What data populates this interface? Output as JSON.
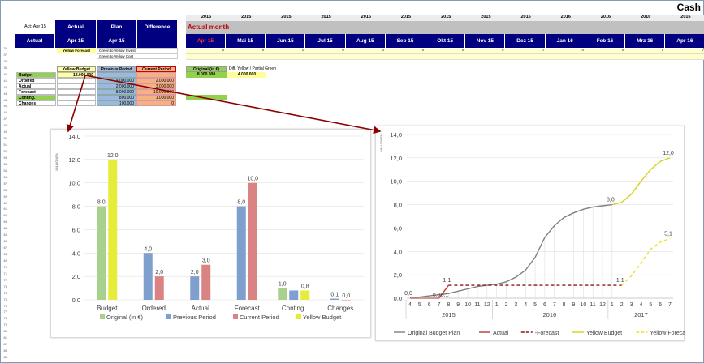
{
  "sheet": {
    "title": "Cash",
    "act_label": "Act: Apr 15",
    "headers": {
      "actual": "Actual",
      "plan": "Plan",
      "difference": "Difference",
      "actual_month": "Actual month"
    },
    "row2": {
      "actual": "Actual",
      "apr": "Apr 15",
      "plan_apr": "Apr 15"
    },
    "years": [
      "2015",
      "2015",
      "2015",
      "2015",
      "2015",
      "2015",
      "2015",
      "2015",
      "2015",
      "2016",
      "2016",
      "2016",
      "2016"
    ],
    "months": [
      "Apr 15",
      "Mai 15",
      "Jun 15",
      "Jul 15",
      "Aug 15",
      "Sep 15",
      "Okt 15",
      "Nov 15",
      "Dez 15",
      "Jan 16",
      "Feb 16",
      "Mrz 16",
      "Apr 16"
    ],
    "yellow_forecast": "Yellow Forecast",
    "green_invest": "Green to Yellow Invest",
    "green_cost": "Green to Yellow Cost",
    "row_cell_value": "0"
  },
  "table": {
    "col_yellow_budget": "Yellow Budget",
    "col_previous": "Previous Period",
    "col_current": "Current Period",
    "col_original": "Original (in €)",
    "diff_label": "Diff. Yellow / Partial Green",
    "diff_value": "4.000.000",
    "original_value": "8.000.000",
    "rows": [
      {
        "label": "Budget",
        "yellow": "12.000.000",
        "prev": "",
        "curr": ""
      },
      {
        "label": "Ordered",
        "yellow": "",
        "prev": "4.000.000",
        "curr": "2.000.000"
      },
      {
        "label": "Actual",
        "yellow": "",
        "prev": "2.000.000",
        "curr": "3.000.000"
      },
      {
        "label": "Forecast",
        "yellow": "",
        "prev": "8.000.000",
        "curr": "10.000.000"
      },
      {
        "label": "Conting.",
        "yellow": "",
        "prev": "800.000",
        "curr": "1.000.000"
      },
      {
        "label": "Changes",
        "yellow": "",
        "prev": "100.000",
        "curr": "0"
      }
    ]
  },
  "chart_data": [
    {
      "type": "bar",
      "ylabel": "MILLIONEN",
      "ylim": [
        0,
        14
      ],
      "yticks": [
        "0,0",
        "2,0",
        "4,0",
        "6,0",
        "8,0",
        "10,0",
        "12,0",
        "14,0"
      ],
      "categories": [
        "Budget",
        "Ordered",
        "Actual",
        "Forecast",
        "Conting.",
        "Changes"
      ],
      "series": [
        {
          "name": "Original (in €)",
          "color": "#a9d18e",
          "values": [
            8.0,
            null,
            null,
            null,
            1.0,
            null
          ],
          "labels": [
            "8,0",
            "",
            "",
            "",
            "1,0",
            ""
          ]
        },
        {
          "name": "Previous Period",
          "color": "#7f9fcf",
          "values": [
            null,
            4.0,
            2.0,
            8.0,
            0.8,
            0.1
          ],
          "labels": [
            "",
            "4,0",
            "2,0",
            "8,0",
            "",
            "0,1"
          ]
        },
        {
          "name": "Current Period",
          "color": "#d98383",
          "values": [
            null,
            2.0,
            3.0,
            10.0,
            null,
            0.0
          ],
          "labels": [
            "",
            "2,0",
            "3,0",
            "10,0",
            "",
            "0,0"
          ]
        },
        {
          "name": "Yellow Budget",
          "color": "#e6ec3a",
          "values": [
            12.0,
            null,
            null,
            null,
            0.8,
            null
          ],
          "labels": [
            "12,0",
            "",
            "",
            "",
            "0,8",
            ""
          ]
        }
      ],
      "legend_position": "bottom",
      "grid": true
    },
    {
      "type": "line",
      "ylabel": "MILLIONEN",
      "ylim": [
        0,
        14
      ],
      "yticks": [
        "0,0",
        "2,0",
        "4,0",
        "6,0",
        "8,0",
        "10,0",
        "12,0",
        "14,0"
      ],
      "x": [
        "4",
        "5",
        "6",
        "7",
        "8",
        "9",
        "10",
        "11",
        "12",
        "1",
        "2",
        "3",
        "4",
        "5",
        "6",
        "7",
        "8",
        "9",
        "10",
        "11",
        "12",
        "1",
        "2",
        "3",
        "4",
        "5",
        "6",
        "7"
      ],
      "year_groups": [
        {
          "label": "2015",
          "span": 9
        },
        {
          "label": "2016",
          "span": 12
        },
        {
          "label": "2017",
          "span": 7
        }
      ],
      "series": [
        {
          "name": "Original Budget Plan",
          "color": "#808080",
          "style": "solid",
          "values": [
            0,
            0.1,
            0.2,
            0.3,
            0.4,
            0.6,
            0.8,
            1.0,
            1.1,
            1.2,
            1.4,
            1.8,
            2.4,
            3.5,
            5.2,
            6.2,
            6.9,
            7.3,
            7.6,
            7.8,
            7.9,
            8.0,
            null,
            null,
            null,
            null,
            null,
            null
          ]
        },
        {
          "name": "Actual",
          "color": "#c0392b",
          "style": "solid",
          "values": [
            0,
            0,
            0,
            0,
            1.1,
            null,
            null,
            null,
            null,
            null,
            null,
            null,
            null,
            null,
            null,
            null,
            null,
            null,
            null,
            null,
            null,
            null,
            null,
            null,
            null,
            null,
            null,
            null
          ]
        },
        {
          "name": "-Forecast",
          "color": "#8b1a1a",
          "style": "dashed",
          "values": [
            null,
            null,
            null,
            null,
            1.1,
            1.1,
            1.1,
            1.1,
            1.1,
            1.1,
            1.1,
            1.1,
            1.1,
            1.1,
            1.1,
            1.1,
            1.1,
            1.1,
            1.1,
            1.1,
            1.1,
            1.1,
            1.1,
            null,
            null,
            null,
            null,
            null
          ]
        },
        {
          "name": "Yellow Budget",
          "color": "#d4d41c",
          "style": "solid",
          "values": [
            null,
            null,
            null,
            null,
            null,
            null,
            null,
            null,
            null,
            null,
            null,
            null,
            null,
            null,
            null,
            null,
            null,
            null,
            null,
            null,
            null,
            8.0,
            8.2,
            8.9,
            10.0,
            11.0,
            11.7,
            12.0
          ]
        },
        {
          "name": "Yellow Forecast",
          "color": "#f0e020",
          "style": "dashed",
          "values": [
            null,
            null,
            null,
            null,
            null,
            null,
            null,
            null,
            null,
            null,
            null,
            null,
            null,
            null,
            null,
            null,
            null,
            null,
            null,
            null,
            null,
            null,
            1.1,
            1.9,
            3.0,
            4.2,
            4.8,
            5.1
          ]
        }
      ],
      "point_labels": [
        {
          "i": 0,
          "s": 0,
          "text": "0,0"
        },
        {
          "i": 4,
          "s": 1,
          "text": "1,1"
        },
        {
          "i": 21,
          "s": 0,
          "text": "8,0"
        },
        {
          "i": 27,
          "s": 3,
          "text": "12,0"
        },
        {
          "i": 22,
          "s": 4,
          "text": "1,1"
        },
        {
          "i": 27,
          "s": 4,
          "text": "5,1"
        }
      ],
      "extra_labels": [
        "0,0",
        "0,1"
      ],
      "legend_position": "bottom",
      "grid": true
    }
  ]
}
